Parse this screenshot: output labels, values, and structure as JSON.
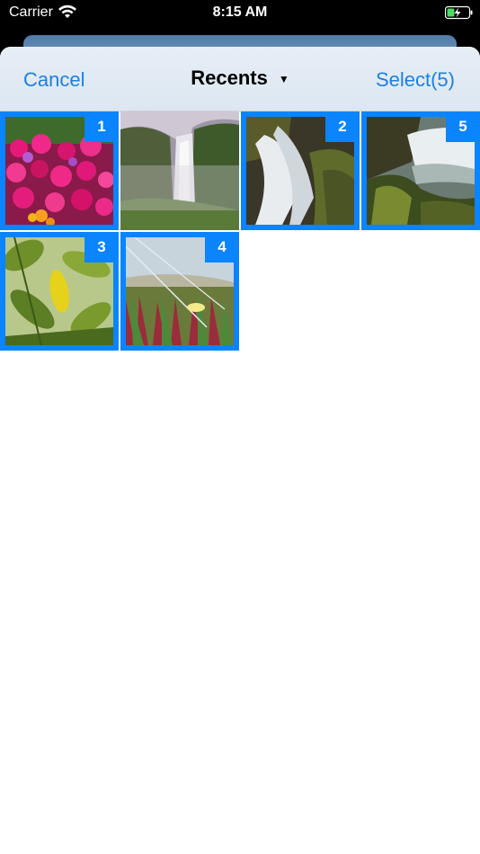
{
  "status_bar": {
    "carrier": "Carrier",
    "time": "8:15 AM",
    "wifi_icon": "wifi-icon",
    "battery_icon": "battery-charging-icon"
  },
  "nav": {
    "cancel_label": "Cancel",
    "title": "Recents",
    "dropdown_icon": "chevron-down-icon",
    "select_label": "Select(5)"
  },
  "photos": [
    {
      "subject": "pink-flowers",
      "selected": true,
      "badge": "1"
    },
    {
      "subject": "waterfall-cliff",
      "selected": false,
      "badge": ""
    },
    {
      "subject": "waterfall-rocks",
      "selected": true,
      "badge": "2"
    },
    {
      "subject": "waterfall-wide",
      "selected": true,
      "badge": "5"
    },
    {
      "subject": "yellow-leaf",
      "selected": true,
      "badge": "3"
    },
    {
      "subject": "ice-plant-flower",
      "selected": true,
      "badge": "4"
    }
  ],
  "colors": {
    "accent": "#0a84ff",
    "link": "#1e7fe0"
  }
}
